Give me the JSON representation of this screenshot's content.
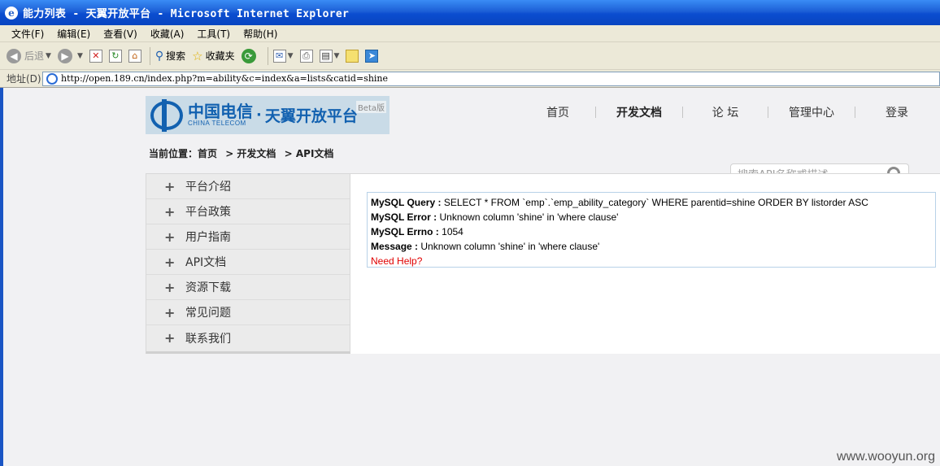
{
  "window": {
    "title": "能力列表 - 天翼开放平台 - Microsoft Internet Explorer"
  },
  "menubar": [
    "文件(F)",
    "编辑(E)",
    "查看(V)",
    "收藏(A)",
    "工具(T)",
    "帮助(H)"
  ],
  "toolbar": {
    "back": "后退",
    "search": "搜索",
    "favorites": "收藏夹"
  },
  "address": {
    "label": "地址(D)",
    "url": "http://open.189.cn/index.php?m=ability&c=index&a=lists&catid=shine"
  },
  "logo": {
    "cn": "中国电信",
    "en": "CHINA TELECOM",
    "dot": "·",
    "name": "天翼开放平台",
    "beta": "Beta版"
  },
  "nav": [
    "首页",
    "开发文档",
    "论 坛",
    "管理中心",
    "登录"
  ],
  "breadcrumb": {
    "label": "当前位置：首页",
    "l1": "> 开发文档",
    "l2": "> API文档"
  },
  "search": {
    "placeholder": "搜索API名称或描述"
  },
  "sidebar": [
    "平台介绍",
    "平台政策",
    "用户指南",
    "API文档",
    "资源下载",
    "常见问题",
    "联系我们"
  ],
  "error": {
    "query_label": "MySQL Query :",
    "query": "SELECT * FROM `emp`.`emp_ability_category` WHERE parentid=shine ORDER BY listorder ASC",
    "error_label": "MySQL Error :",
    "error": "Unknown column 'shine' in 'where clause'",
    "errno_label": "MySQL Errno :",
    "errno": "1054",
    "message_label": "Message :",
    "message": "Unknown column 'shine' in 'where clause'",
    "help": "Need Help?"
  },
  "watermark": "www.wooyun.org"
}
